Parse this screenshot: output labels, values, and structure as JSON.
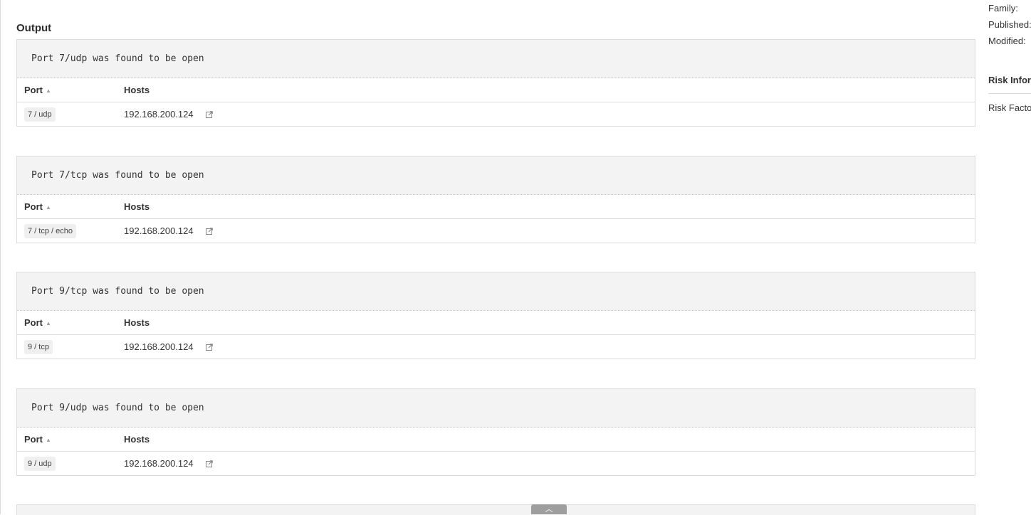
{
  "output": {
    "title": "Output",
    "blocks": [
      {
        "text": "Port 7/udp was found to be open",
        "port_header": "Port",
        "hosts_header": "Hosts",
        "port": "7 / udp",
        "host": "192.168.200.124"
      },
      {
        "text": "Port 7/tcp was found to be open",
        "port_header": "Port",
        "hosts_header": "Hosts",
        "port": "7 / tcp / echo",
        "host": "192.168.200.124"
      },
      {
        "text": "Port 9/tcp was found to be open",
        "port_header": "Port",
        "hosts_header": "Hosts",
        "port": "9 / tcp",
        "host": "192.168.200.124"
      },
      {
        "text": "Port 9/udp was found to be open",
        "port_header": "Port",
        "hosts_header": "Hosts",
        "port": "9 / udp",
        "host": "192.168.200.124"
      }
    ]
  },
  "sidebar": {
    "family_label": "Family:",
    "published_label": "Published:",
    "modified_label": "Modified:",
    "risk_heading": "Risk Infor",
    "risk_factor_label": "Risk Facto"
  },
  "icons": {
    "sort": "sort-ascending-icon",
    "external_link": "external-link-icon",
    "scroll_top": "chevron-up-icon"
  },
  "colors": {
    "pre_background": "#f3f3f3",
    "border": "#dcdcdc",
    "badge_background": "#efefef",
    "scroll_button": "#9e9e9e"
  }
}
